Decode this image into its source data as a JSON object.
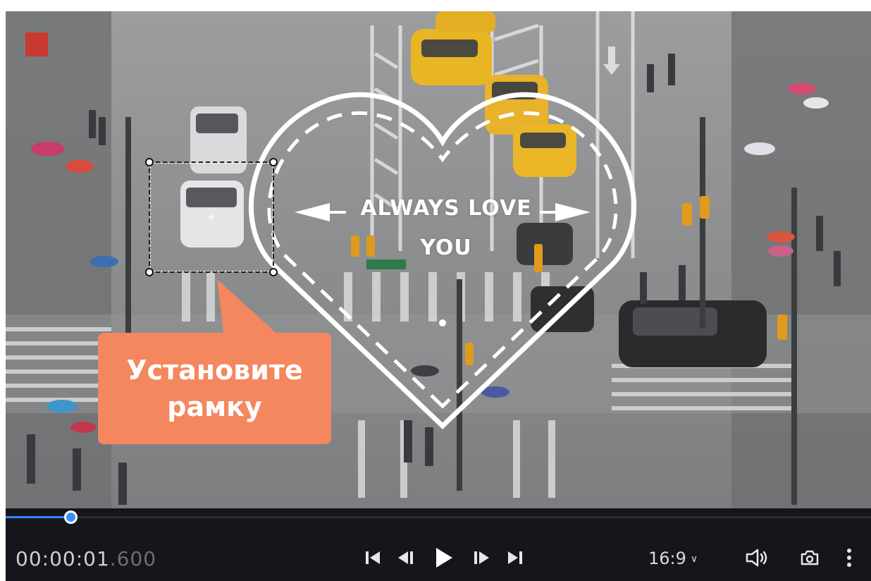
{
  "callout": {
    "line1": "Установите",
    "line2": "рамку"
  },
  "sticker": {
    "line1": "ALWAYS LOVE",
    "line2": "YOU"
  },
  "player": {
    "timecode_main": "00:00:01",
    "timecode_ms": ".600",
    "progress": 0.075,
    "aspect_ratio": "16:9",
    "icons": {
      "go_to_start": "skip-to-start-icon",
      "previous_frame": "previous-frame-icon",
      "play": "play-icon",
      "next_frame": "next-frame-icon",
      "go_to_end": "skip-to-end-icon",
      "aspect_dropdown": "chevron-down-icon",
      "volume": "volume-icon",
      "snapshot": "camera-icon",
      "more": "more-vertical-icon"
    }
  },
  "colors": {
    "accent": "#2f8cf5",
    "callout": "#f4875d",
    "control_bar": "#15161c"
  }
}
